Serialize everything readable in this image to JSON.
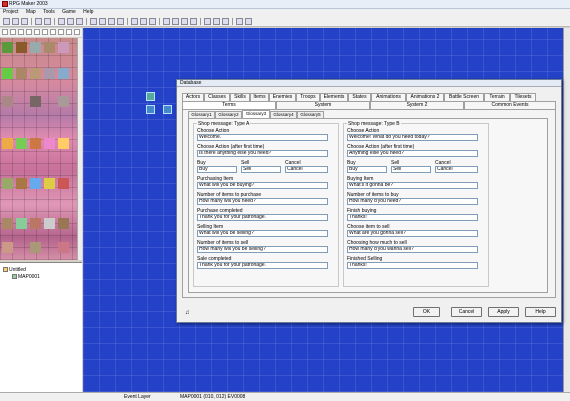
{
  "app": {
    "title": "RPG Maker 2003"
  },
  "menu": [
    "Project",
    "Map",
    "Tools",
    "Game",
    "Help"
  ],
  "tree": {
    "root": "Untitled",
    "map": "MAP0001"
  },
  "status": {
    "layer": "Event Layer",
    "position": "MAP0001 (010, 012) EV0008"
  },
  "dialog": {
    "title": "Database",
    "tabs_row1": [
      "Actors",
      "Classes",
      "Skills",
      "Items",
      "Enemies",
      "Troops",
      "Elements",
      "States",
      "Animations",
      "Animations 2",
      "Battle Screen",
      "Terrain",
      "Tilesets"
    ],
    "tabs_row2": [
      "Terms",
      "System",
      "System 2",
      "Common Events"
    ],
    "subtabs": [
      "Glossary1",
      "Glossary2",
      "Glossary3",
      "Glossary4",
      "Glossary5"
    ],
    "active_subtab": "Glossary3",
    "shopA": {
      "title": "Shop message: Type A",
      "choose_action_label": "Choose Action",
      "choose_action": "Welcome.",
      "after_first_label": "Choose Action (after first time)",
      "after_first": "Is there anything else you need?",
      "buy_label": "Buy",
      "buy": "Buy",
      "sell_label": "Sell",
      "sell": "Sell",
      "cancel_label": "Cancel",
      "cancel": "Cancel",
      "purchasing_label": "Purchasing Item",
      "purchasing": "What will you be buying?",
      "num_buy_label": "Number of items to purchase",
      "num_buy": "How many will you need?",
      "purchase_done_label": "Purchase completed",
      "purchase_done": "Thank you for your patronage.",
      "selling_label": "Selling Item",
      "selling": "What will you be selling?",
      "num_sell_label": "Number of items to sell",
      "num_sell": "How many will you be selling?",
      "sale_done_label": "Sale completed",
      "sale_done": "Thank you for your patronage."
    },
    "shopB": {
      "title": "Shop message: Type B",
      "choose_action_label": "Choose Action",
      "choose_action": "Welcome! What do you need today?",
      "after_first_label": "Choose Action (after first time)",
      "after_first": "Anything else you need?",
      "buy_label": "Buy",
      "buy": "Buy",
      "sell_label": "Sell",
      "sell": "Sell",
      "cancel_label": "Cancel",
      "cancel": "Cancel",
      "buying_label": "Buying Item",
      "buying": "What's it gonna be?",
      "num_buy_label": "Number of items to buy",
      "num_buy": "How many d'you need?",
      "finish_buying_label": "Finish buying",
      "finish_buying": "Thanks!",
      "choose_sell_label": "Choose item to sell",
      "choose_sell": "What are you gonna sell?",
      "how_much_label": "Choosing how much to sell",
      "how_much": "How many d'you wanna sell?",
      "finished_selling_label": "Finished Selling",
      "finished_selling": "Thanks!"
    },
    "music_icon": "music-note-icon",
    "buttons": {
      "ok": "OK",
      "cancel": "Cancel",
      "apply": "Apply",
      "help": "Help"
    }
  }
}
